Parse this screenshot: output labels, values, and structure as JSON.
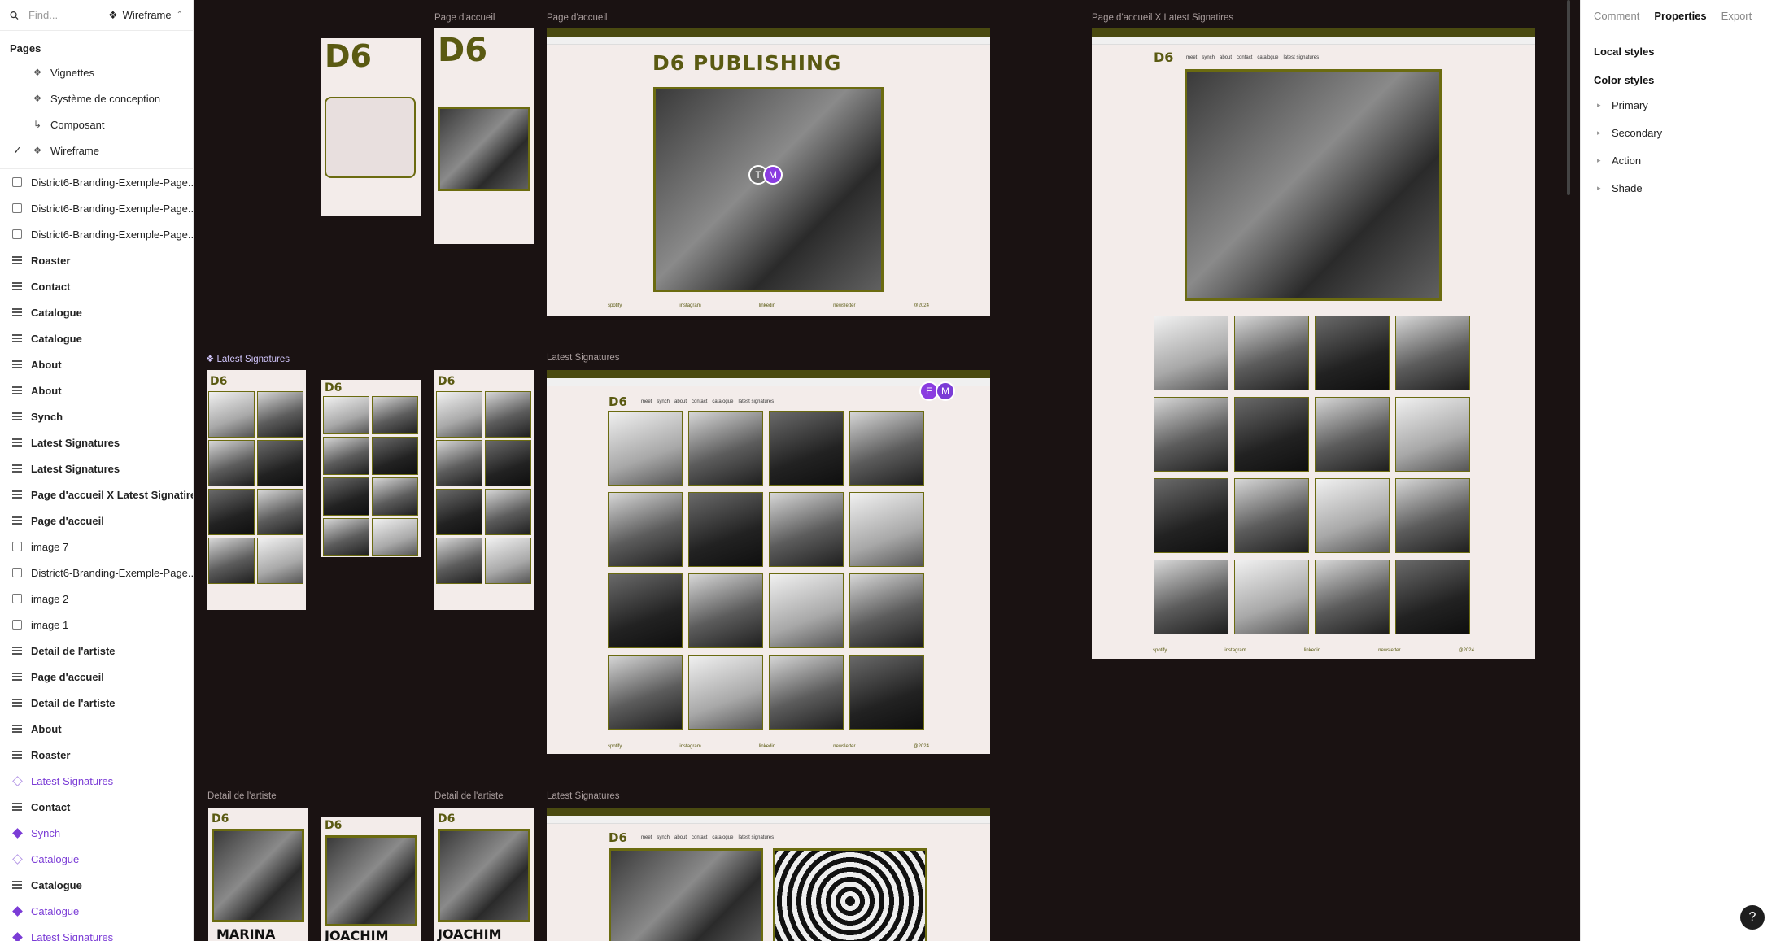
{
  "search": {
    "placeholder": "Find...",
    "current_page": "Wireframe"
  },
  "pages": {
    "title": "Pages",
    "items": [
      {
        "label": "Vignettes",
        "active": false
      },
      {
        "label": "Système de conception",
        "active": false
      },
      {
        "label": "Composant",
        "active": false
      },
      {
        "label": "Wireframe",
        "active": true
      }
    ]
  },
  "layers": [
    {
      "label": "District6-Branding-Exemple-Page...",
      "type": "image"
    },
    {
      "label": "District6-Branding-Exemple-Page...",
      "type": "image"
    },
    {
      "label": "District6-Branding-Exemple-Page...",
      "type": "image"
    },
    {
      "label": "Roaster",
      "type": "frame"
    },
    {
      "label": "Contact",
      "type": "frame"
    },
    {
      "label": "Catalogue",
      "type": "frame"
    },
    {
      "label": "Catalogue",
      "type": "frame"
    },
    {
      "label": "About",
      "type": "frame"
    },
    {
      "label": "About",
      "type": "frame"
    },
    {
      "label": "Synch",
      "type": "frame"
    },
    {
      "label": "Latest Signatures",
      "type": "frame"
    },
    {
      "label": "Latest Signatures",
      "type": "frame"
    },
    {
      "label": "Page d'accueil X Latest Signatires",
      "type": "frame"
    },
    {
      "label": "Page d'accueil",
      "type": "frame"
    },
    {
      "label": "image 7",
      "type": "image"
    },
    {
      "label": "District6-Branding-Exemple-Page...",
      "type": "image"
    },
    {
      "label": "image 2",
      "type": "image"
    },
    {
      "label": "image 1",
      "type": "image"
    },
    {
      "label": "Detail de l'artiste",
      "type": "frame"
    },
    {
      "label": "Page d'accueil",
      "type": "frame"
    },
    {
      "label": "Detail de l'artiste",
      "type": "frame"
    },
    {
      "label": "About",
      "type": "frame"
    },
    {
      "label": "Roaster",
      "type": "frame"
    },
    {
      "label": "Latest Signatures",
      "type": "component-outline"
    },
    {
      "label": "Contact",
      "type": "frame"
    },
    {
      "label": "Synch",
      "type": "component"
    },
    {
      "label": "Catalogue",
      "type": "component-outline"
    },
    {
      "label": "Catalogue",
      "type": "frame"
    },
    {
      "label": "Catalogue",
      "type": "component"
    },
    {
      "label": "Latest Signatures",
      "type": "component"
    }
  ],
  "right_panel": {
    "tabs": [
      "Comment",
      "Properties",
      "Export"
    ],
    "active_tab": "Properties",
    "local_styles": "Local styles",
    "color_styles": "Color styles",
    "colors": [
      "Primary",
      "Secondary",
      "Action",
      "Shade"
    ]
  },
  "canvas": {
    "labels": {
      "page_accueil_1": "Page d'accueil",
      "page_accueil_2": "Page d'accueil",
      "page_accueil_x": "Page d'accueil X Latest Signatires",
      "latest_comp": "Latest Signatures",
      "latest_desktop": "Latest Signatures",
      "detail_1": "Detail de l'artiste",
      "detail_2": "Detail de l'artiste",
      "latest_bottom": "Latest Signatures"
    },
    "logo": "D6",
    "publishing_title": "D6 PUBLISHING",
    "footer": [
      "spotify",
      "instagram",
      "linkedin",
      "newsletter",
      "@2024"
    ],
    "nav": [
      "meet",
      "synch",
      "about",
      "contact",
      "catalogue",
      "latest signatures"
    ],
    "artist_names": [
      "MARINA",
      "JOACHIM",
      "JOACHIM"
    ],
    "avatars": [
      {
        "letter": "T",
        "color": "#6b6b6b"
      },
      {
        "letter": "M",
        "color": "#8a3ce0"
      },
      {
        "letter": "E",
        "color": "#8a3ce0"
      },
      {
        "letter": "M",
        "color": "#7b3cd6"
      }
    ]
  },
  "help": "?"
}
